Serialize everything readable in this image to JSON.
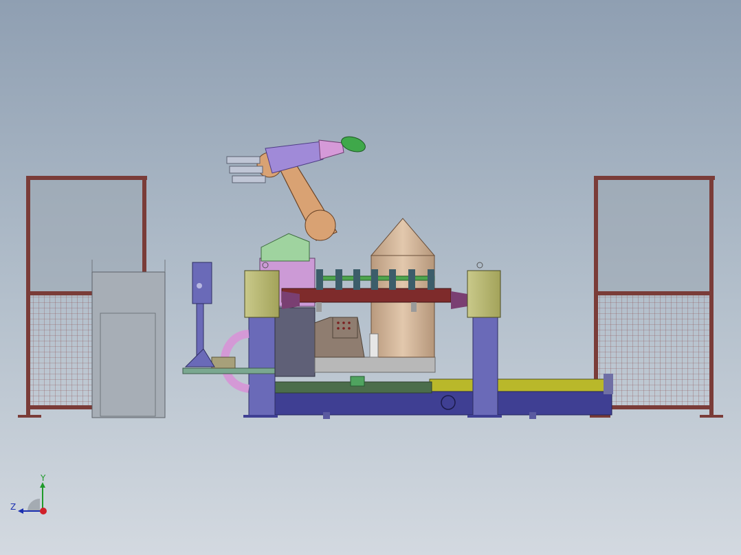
{
  "viewport": {
    "background_top": "#8f9fb2",
    "background_bottom": "#d3d9e0"
  },
  "colors": {
    "fence_frame": "#7a3c38",
    "fence_mesh": "#8a2d2d",
    "base_blue": "#3f3f93",
    "column_blue": "#6a6ab8",
    "housing_yellow": "#b8b86a",
    "robot_orange": "#d9a273",
    "robot_purple": "#a08ad8",
    "robot_green": "#9fd39f",
    "fixture_bar": "#7e2b2b",
    "cone_tan": "#d6b99c",
    "pink_hose": "#d499d6",
    "rail_yellow": "#b9b82a"
  },
  "triad": {
    "y_label": "Y",
    "z_label": "Z",
    "y_color": "#1f9a2a",
    "z_color": "#1a2fb0",
    "x_color": "#d0202a"
  }
}
